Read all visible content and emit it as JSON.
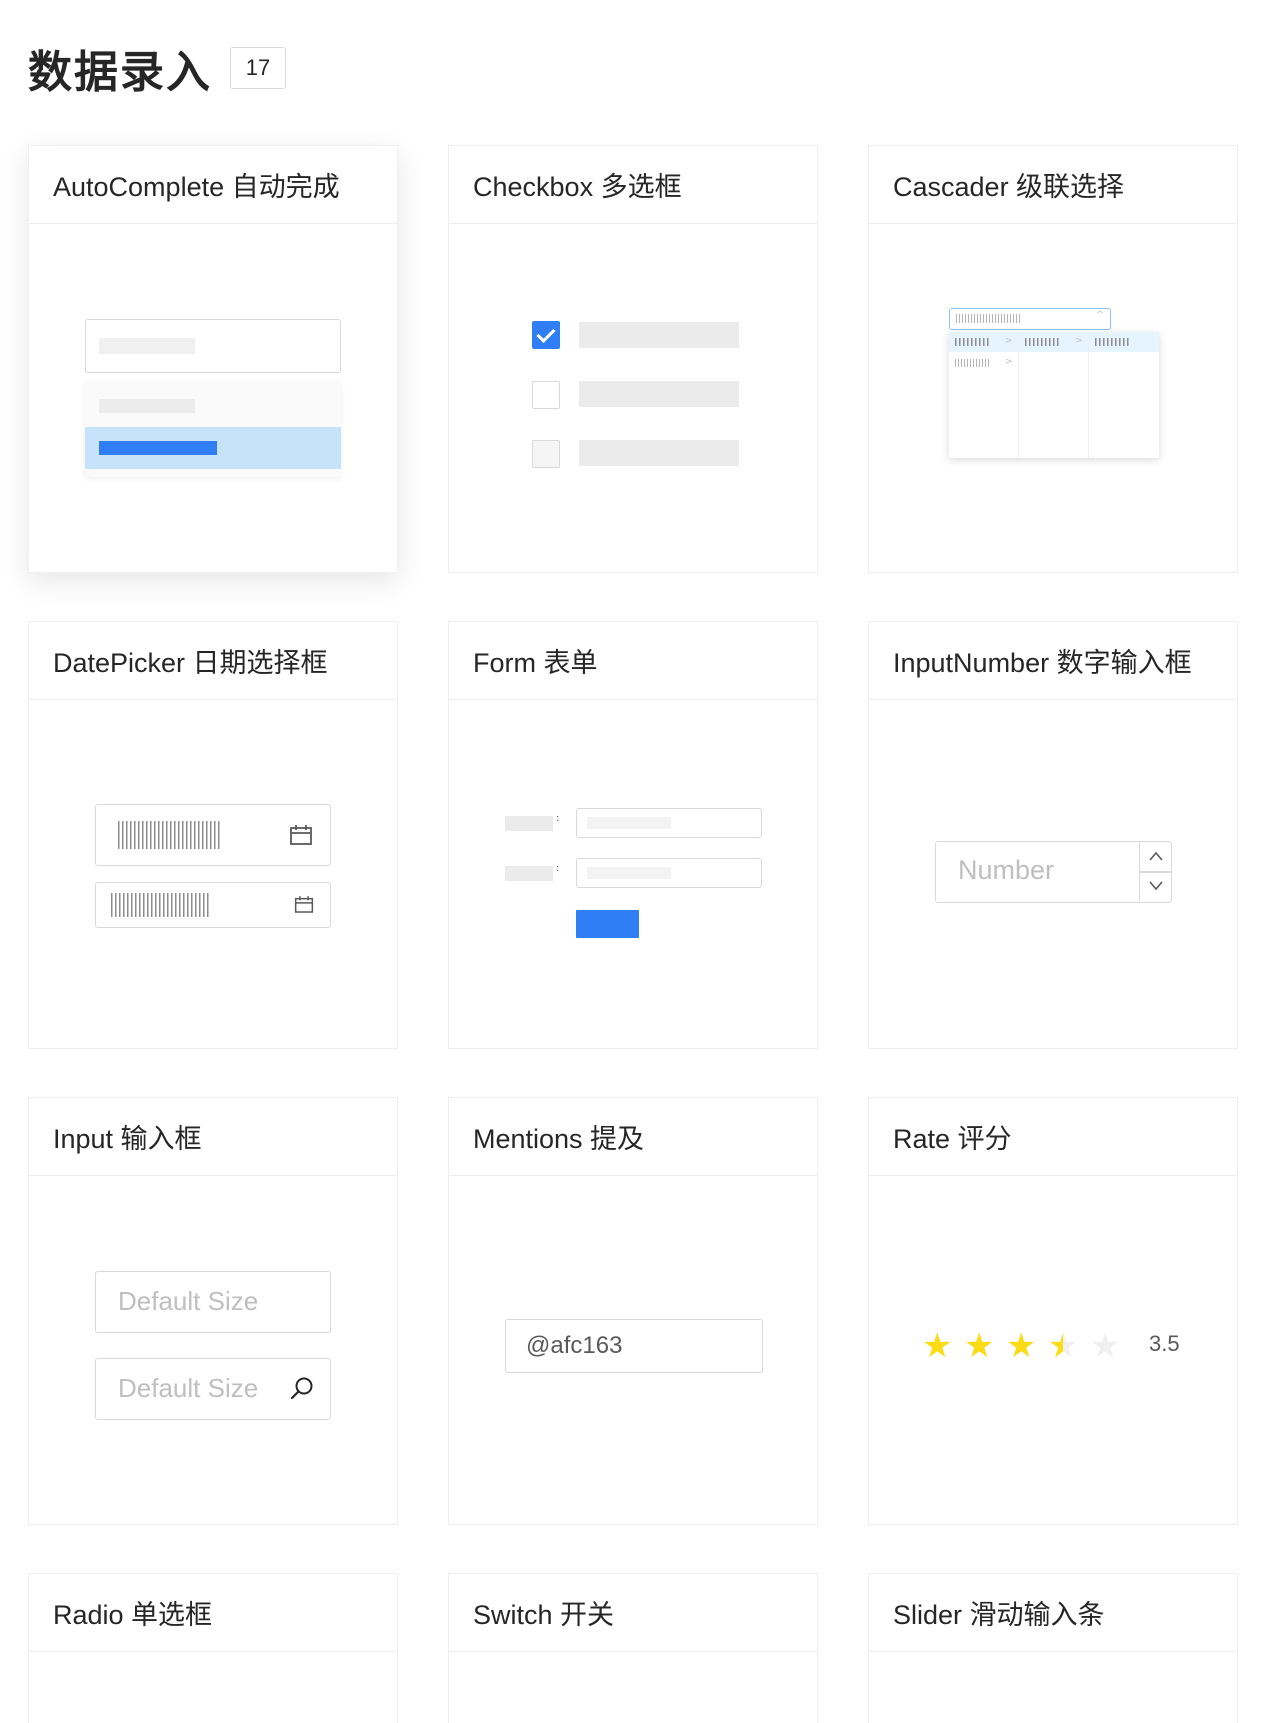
{
  "header": {
    "title": "数据录入",
    "count": "17"
  },
  "cards": {
    "autocomplete": {
      "title": "AutoComplete 自动完成"
    },
    "checkbox": {
      "title": "Checkbox 多选框"
    },
    "cascader": {
      "title": "Cascader 级联选择"
    },
    "datepicker": {
      "title": "DatePicker 日期选择框"
    },
    "form": {
      "title": "Form 表单",
      "label_colon": ":"
    },
    "inputnumber": {
      "title": "InputNumber 数字输入框",
      "placeholder": "Number"
    },
    "input": {
      "title": "Input 输入框",
      "placeholder_1": "Default Size",
      "placeholder_2": "Default Size"
    },
    "mentions": {
      "title": "Mentions 提及",
      "value": "@afc163"
    },
    "rate": {
      "title": "Rate 评分",
      "value_label": "3.5",
      "value": 3.5,
      "max": 5
    },
    "radio": {
      "title": "Radio 单选框"
    },
    "switch": {
      "title": "Switch 开关"
    },
    "slider": {
      "title": "Slider 滑动输入条"
    }
  },
  "colors": {
    "primary": "#2f7ef5",
    "star": "#fadb14",
    "selected_option": "#c7e3fc"
  },
  "icons": [
    "calendar-icon",
    "search-icon",
    "check-icon",
    "chevron-up-icon",
    "chevron-down-icon",
    "star-icon"
  ]
}
